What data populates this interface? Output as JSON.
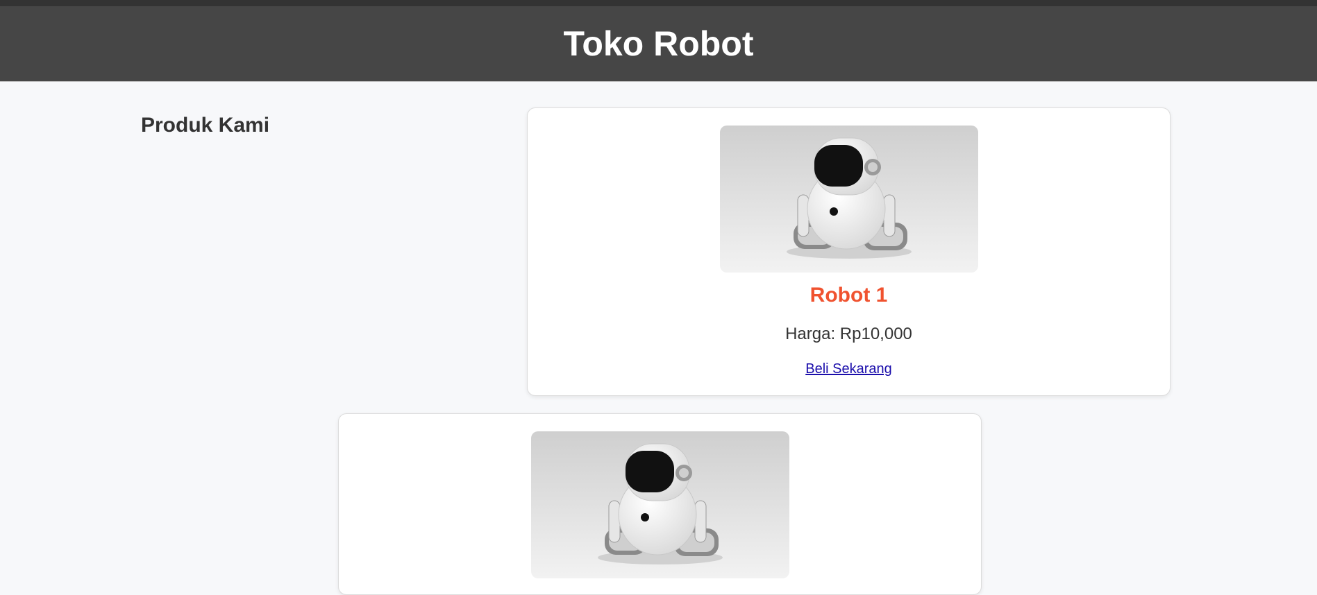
{
  "header": {
    "title": "Toko Robot"
  },
  "section": {
    "title": "Produk Kami"
  },
  "products": [
    {
      "name": "Robot 1",
      "price": "Harga: Rp10,000",
      "buy_label": "Beli Sekarang",
      "image": "robot-image"
    },
    {
      "image": "robot-image"
    }
  ],
  "colors": {
    "header_bg": "#464646",
    "accent": "#f0522f",
    "link": "#1a0dab",
    "page_bg": "#f7f8fa"
  }
}
